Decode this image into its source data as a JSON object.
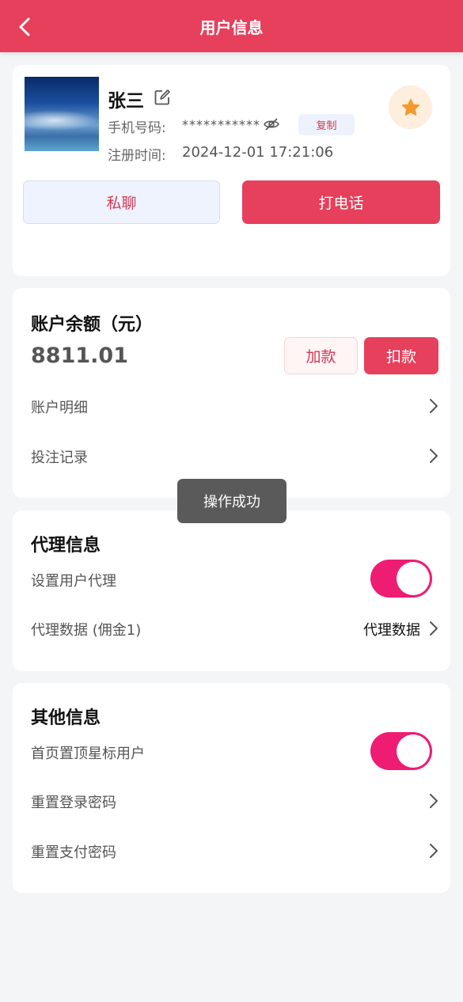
{
  "header": {
    "title": "用户信息"
  },
  "profile": {
    "name": "张三",
    "phone_label": "手机号码:",
    "phone_value": "***********",
    "copy_label": "复制",
    "reg_label": "注册时间:",
    "reg_value": "2024-12-01 17:21:06",
    "chat_label": "私聊",
    "call_label": "打电话"
  },
  "account": {
    "title": "账户余额（元）",
    "balance": "8811.01",
    "add_label": "加款",
    "deduct_label": "扣款",
    "rows": [
      {
        "label": "账户明细"
      },
      {
        "label": "投注记录"
      }
    ]
  },
  "agent": {
    "title": "代理信息",
    "set_agent_label": "设置用户代理",
    "set_agent_on": true,
    "data_label": "代理数据 (佣金1)",
    "data_value": "代理数据"
  },
  "other": {
    "title": "其他信息",
    "star_top_label": "首页置顶星标用户",
    "star_top_on": true,
    "rows": [
      {
        "label": "重置登录密码"
      },
      {
        "label": "重置支付密码"
      }
    ]
  },
  "toast": {
    "text": "操作成功"
  },
  "colors": {
    "primary": "#e6405c",
    "toggle_on": "#ee1c72",
    "star": "#f39a2e",
    "page_bg": "#f4f5f7"
  },
  "icons": {
    "back": "chevron-left-icon",
    "edit": "edit-icon",
    "eye": "eye-off-icon",
    "star": "star-icon",
    "chevron": "chevron-right-icon"
  }
}
